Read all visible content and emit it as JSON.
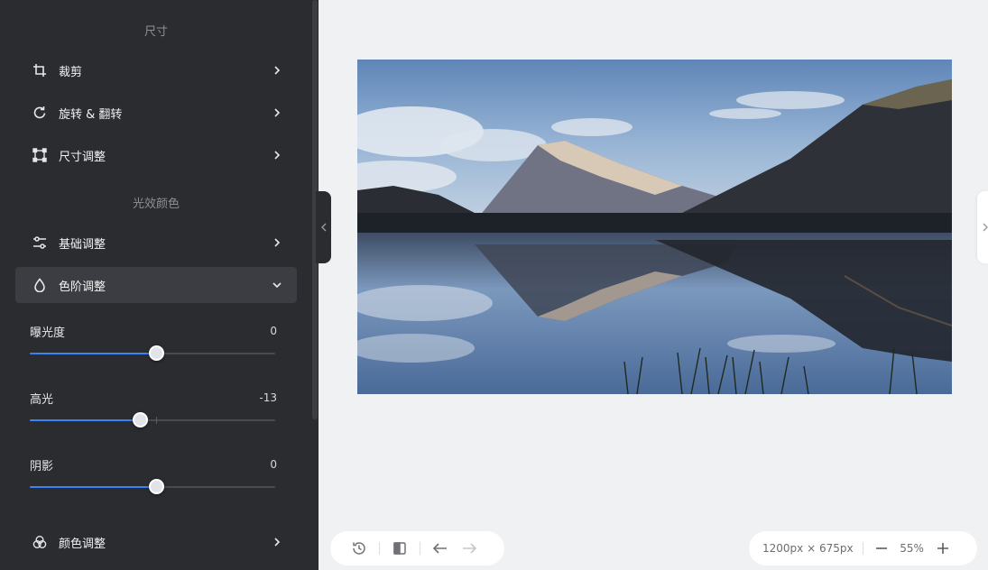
{
  "sidebar": {
    "section_size": "尺寸",
    "section_light": "光效颜色",
    "items": [
      {
        "label": "裁剪",
        "icon": "crop-icon"
      },
      {
        "label": "旋转 & 翻转",
        "icon": "rotate-icon"
      },
      {
        "label": "尺寸调整",
        "icon": "resize-icon"
      },
      {
        "label": "基础调整",
        "icon": "sliders-icon"
      },
      {
        "label": "色阶调整",
        "icon": "droplet-icon",
        "expanded": true
      },
      {
        "label": "颜色调整",
        "icon": "color-circles-icon"
      }
    ],
    "sliders": [
      {
        "label": "曝光度",
        "value": "0",
        "position": 0.515
      },
      {
        "label": "高光",
        "value": "-13",
        "position": 0.447
      },
      {
        "label": "阴影",
        "value": "0",
        "position": 0.515
      }
    ]
  },
  "canvas": {
    "dimensions": "1200px × 675px",
    "zoom": "55%"
  },
  "colors": {
    "sidebar_bg": "#2b2c30",
    "accent": "#3b82f6",
    "canvas_bg": "#f0f1f3"
  }
}
